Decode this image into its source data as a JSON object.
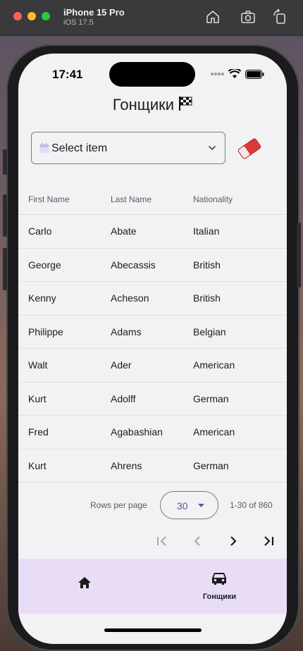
{
  "simulator": {
    "device": "iPhone 15 Pro",
    "os": "iOS 17.5"
  },
  "status_bar": {
    "time": "17:41"
  },
  "app": {
    "title": "Гонщики",
    "filter": {
      "placeholder": "Select item"
    },
    "table": {
      "headers": [
        "First Name",
        "Last Name",
        "Nationality"
      ],
      "rows": [
        [
          "Carlo",
          "Abate",
          "Italian"
        ],
        [
          "George",
          "Abecassis",
          "British"
        ],
        [
          "Kenny",
          "Acheson",
          "British"
        ],
        [
          "Philippe",
          "Adams",
          "Belgian"
        ],
        [
          "Walt",
          "Ader",
          "American"
        ],
        [
          "Kurt",
          "Adolff",
          "German"
        ],
        [
          "Fred",
          "Agabashian",
          "American"
        ],
        [
          "Kurt",
          "Ahrens",
          "German"
        ]
      ]
    },
    "pagination": {
      "rows_per_page_label": "Rows per page",
      "rows_per_page": "30",
      "range": "1-30 of 860"
    },
    "bottom_nav": {
      "items": [
        {
          "icon": "home-icon",
          "label": ""
        },
        {
          "icon": "car-icon",
          "label": "Гонщики"
        }
      ]
    }
  },
  "colors": {
    "accent": "#6750a4",
    "nav_background": "#e9ddf6",
    "eraser": "#d93a3a"
  }
}
